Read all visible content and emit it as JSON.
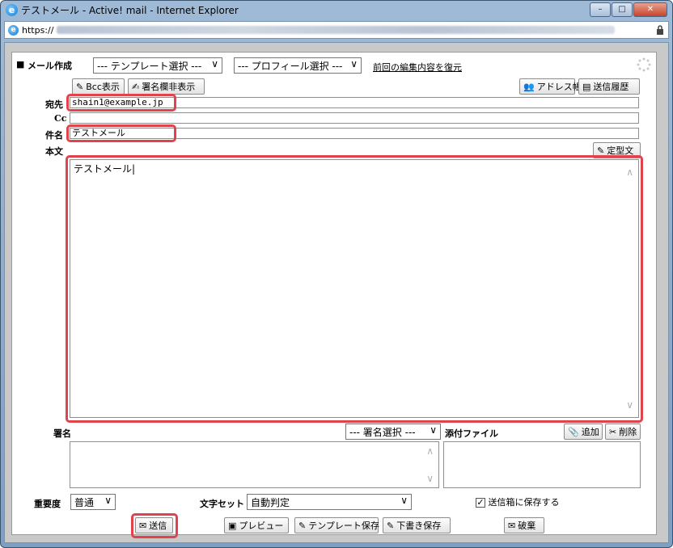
{
  "window": {
    "title": "テストメール - Active! mail - Internet Explorer",
    "url_prefix": "https://"
  },
  "toolbar": {
    "mode_label": "メール作成",
    "template_select": "--- テンプレート選択 ---",
    "profile_select": "--- プロフィール選択 ---",
    "restore_link": "前回の編集内容を復元",
    "bcc_button": "Bcc表示",
    "signature_toggle_button": "署名欄非表示",
    "address_book_button": "アドレス帳",
    "send_history_button": "送信履歴"
  },
  "fields": {
    "to_label": "宛先",
    "to_value": "shain1@example.jp",
    "cc_label": "Cc",
    "cc_value": "",
    "subject_label": "件名",
    "subject_value": "テストメール",
    "body_label": "本文",
    "body_value": "テストメール",
    "fixed_phrase_button": "定型文"
  },
  "signature": {
    "label": "署名",
    "select": "--- 署名選択 ---"
  },
  "attachments": {
    "label": "添付ファイル",
    "add_button": "追加",
    "delete_button": "削除"
  },
  "options": {
    "priority_label": "重要度",
    "priority_value": "普通",
    "charset_label": "文字セット",
    "charset_value": "自動判定",
    "save_to_sent_label": "送信箱に保存する",
    "save_to_sent_checked": true
  },
  "actions": {
    "send": "送信",
    "preview": "プレビュー",
    "save_template": "テンプレート保存",
    "save_draft": "下書き保存",
    "discard": "破棄"
  },
  "colors": {
    "highlight": "#e0434b"
  }
}
